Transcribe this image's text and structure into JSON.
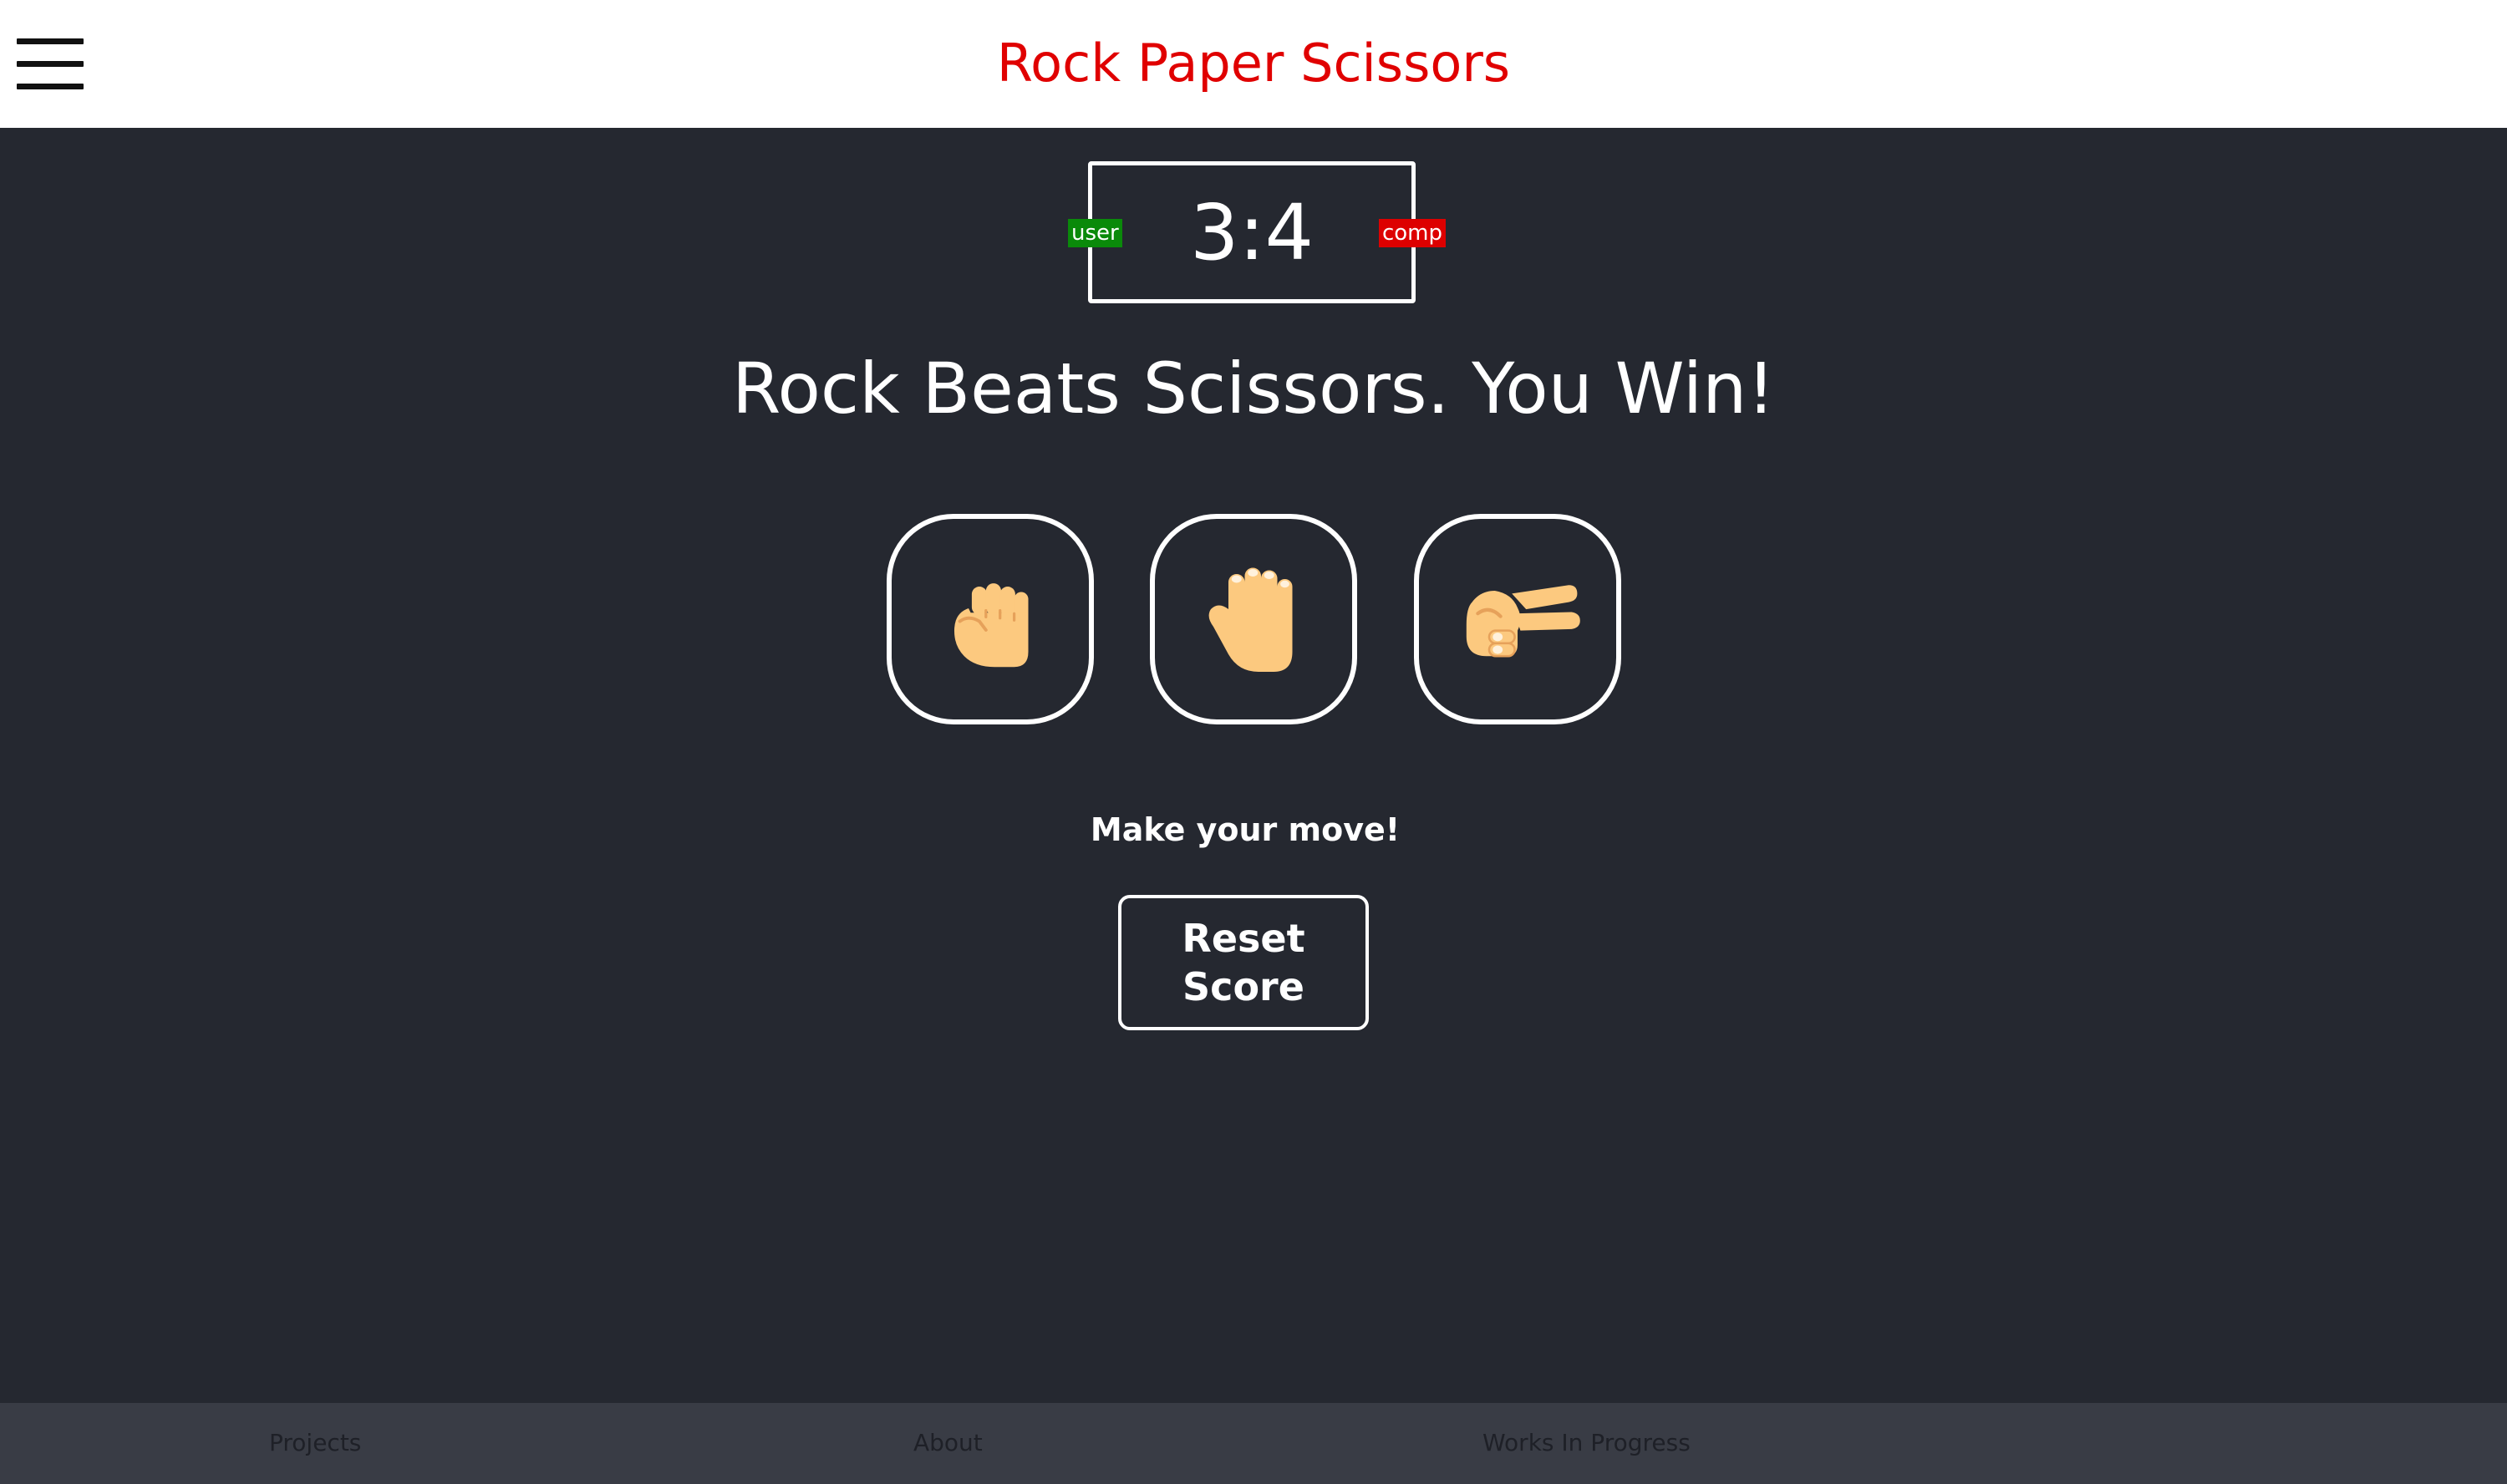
{
  "header": {
    "title": "Rock Paper Scissors",
    "menu_icon": "hamburger-menu-icon",
    "title_color": "#e00000"
  },
  "scoreboard": {
    "score": "3:4",
    "user_label": "user",
    "comp_label": "comp",
    "user_color": "#0a8a0a",
    "comp_color": "#dd0000"
  },
  "result": {
    "message": "Rock Beats Scissors. You Win!"
  },
  "choices": [
    {
      "name": "rock",
      "icon": "raised-fist-icon"
    },
    {
      "name": "paper",
      "icon": "raised-hand-icon"
    },
    {
      "name": "scissors",
      "icon": "victory-hand-icon"
    }
  ],
  "prompt": "Make your move!",
  "reset_label": "Reset Score",
  "footer": {
    "links": [
      "Projects",
      "About",
      "Works In Progress"
    ]
  },
  "colors": {
    "background": "#252830",
    "footer_background": "#393c45",
    "hand_skin": "#fcc97f"
  }
}
